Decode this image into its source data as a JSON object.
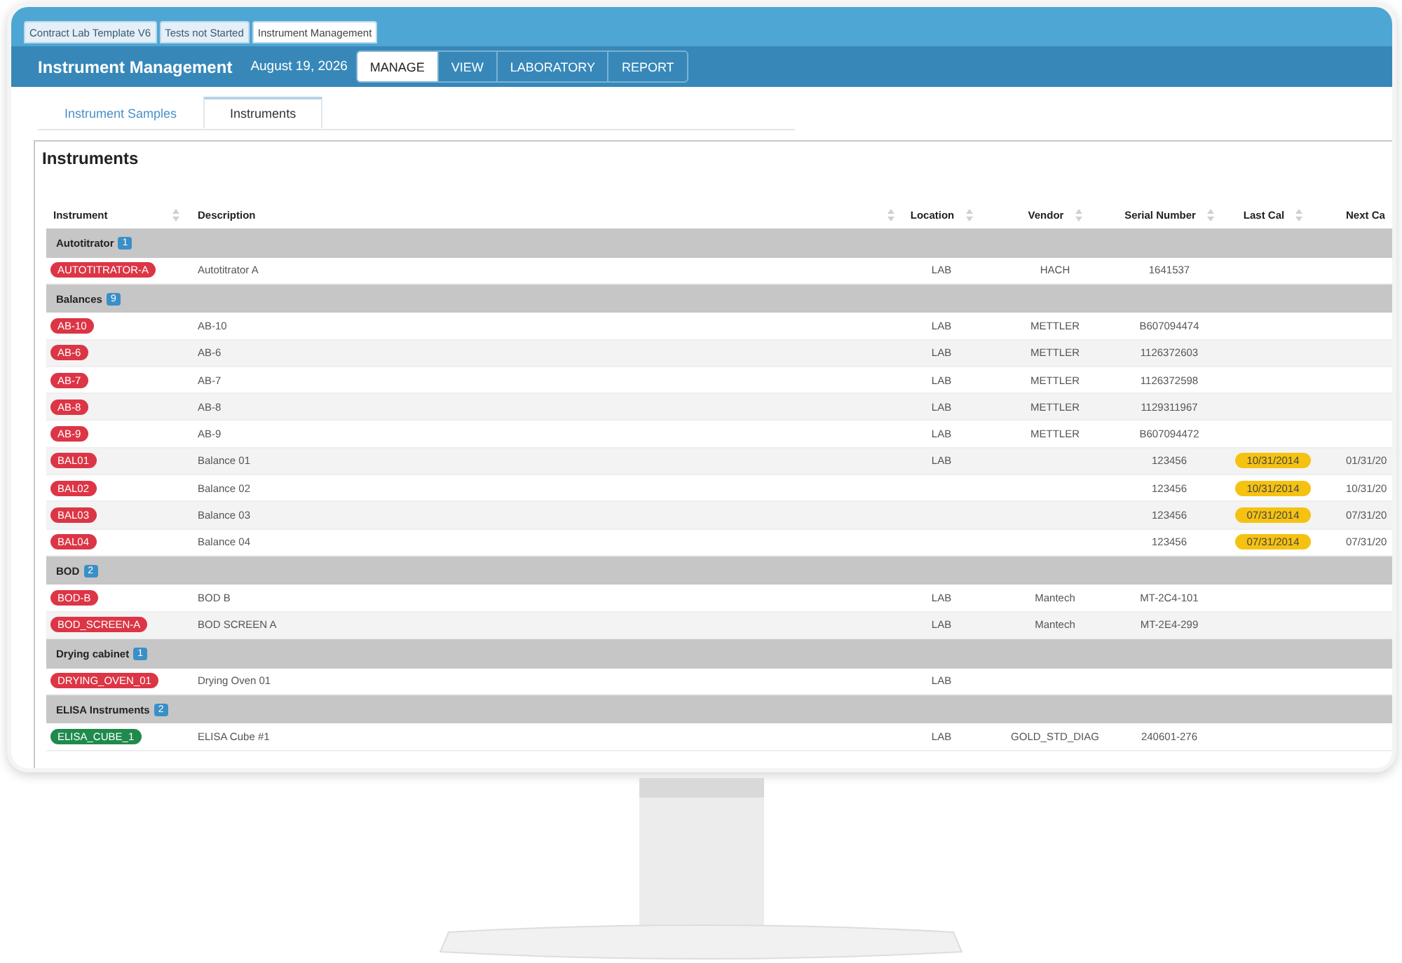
{
  "browser_tabs": [
    {
      "label": "Contract Lab Template V6",
      "selected": false
    },
    {
      "label": "Tests not Started",
      "selected": false
    },
    {
      "label": "Instrument Management",
      "selected": true
    }
  ],
  "header": {
    "title": "Instrument Management",
    "date": "August 19, 2026",
    "nav": [
      {
        "label": "MANAGE",
        "selected": true
      },
      {
        "label": "VIEW",
        "selected": false
      },
      {
        "label": "LABORATORY",
        "selected": false
      },
      {
        "label": "REPORT",
        "selected": false
      }
    ]
  },
  "subtabs": [
    {
      "label": "Instrument Samples",
      "selected": false
    },
    {
      "label": "Instruments",
      "selected": true
    }
  ],
  "panel": {
    "title": "Instruments",
    "columns": [
      {
        "label": "Instrument",
        "sortable": true
      },
      {
        "label": "Description",
        "sortable": true
      },
      {
        "label": "Location",
        "sortable": true
      },
      {
        "label": "Vendor",
        "sortable": true
      },
      {
        "label": "Serial Number",
        "sortable": true
      },
      {
        "label": "Last Cal",
        "sortable": true
      },
      {
        "label": "Next Ca",
        "sortable": false
      }
    ],
    "groups": [
      {
        "name": "Autotitrator",
        "count": "1",
        "rows": [
          {
            "instrument": "AUTOTITRATOR-A",
            "color": "#dc3545",
            "description": "Autotitrator A",
            "location": "LAB",
            "vendor": "HACH",
            "serial": "1641537"
          }
        ]
      },
      {
        "name": "Balances",
        "count": "9",
        "rows": [
          {
            "instrument": "AB-10",
            "color": "#dc3545",
            "description": "AB-10",
            "location": "LAB",
            "vendor": "METTLER",
            "serial": "B607094474"
          },
          {
            "instrument": "AB-6",
            "color": "#dc3545",
            "description": "AB-6",
            "location": "LAB",
            "vendor": "METTLER",
            "serial": "1126372603"
          },
          {
            "instrument": "AB-7",
            "color": "#dc3545",
            "description": "AB-7",
            "location": "LAB",
            "vendor": "METTLER",
            "serial": "1126372598"
          },
          {
            "instrument": "AB-8",
            "color": "#dc3545",
            "description": "AB-8",
            "location": "LAB",
            "vendor": "METTLER",
            "serial": "1129311967"
          },
          {
            "instrument": "AB-9",
            "color": "#dc3545",
            "description": "AB-9",
            "location": "LAB",
            "vendor": "METTLER",
            "serial": "B607094472"
          },
          {
            "instrument": "BAL01",
            "color": "#dc3545",
            "description": "Balance 01",
            "location": "LAB",
            "serial": "123456",
            "last_cal": "10/31/2014",
            "next_cal": "01/31/20"
          },
          {
            "instrument": "BAL02",
            "color": "#dc3545",
            "description": "Balance 02",
            "serial": "123456",
            "last_cal": "10/31/2014",
            "next_cal": "10/31/20"
          },
          {
            "instrument": "BAL03",
            "color": "#dc3545",
            "description": "Balance 03",
            "serial": "123456",
            "last_cal": "07/31/2014",
            "next_cal": "07/31/20"
          },
          {
            "instrument": "BAL04",
            "color": "#dc3545",
            "description": "Balance 04",
            "serial": "123456",
            "last_cal": "07/31/2014",
            "next_cal": "07/31/20"
          }
        ]
      },
      {
        "name": "BOD",
        "count": "2",
        "rows": [
          {
            "instrument": "BOD-B",
            "color": "#dc3545",
            "description": "BOD B",
            "location": "LAB",
            "vendor": "Mantech",
            "serial": "MT-2C4-101"
          },
          {
            "instrument": "BOD_SCREEN-A",
            "color": "#dc3545",
            "description": "BOD SCREEN A",
            "location": "LAB",
            "vendor": "Mantech",
            "serial": "MT-2E4-299"
          }
        ]
      },
      {
        "name": "Drying cabinet",
        "count": "1",
        "rows": [
          {
            "instrument": "DRYING_OVEN_01",
            "color": "#dc3545",
            "description": "Drying Oven 01",
            "location": "LAB"
          }
        ]
      },
      {
        "name": "ELISA Instruments",
        "count": "2",
        "rows": [
          {
            "instrument": "ELISA_CUBE_1",
            "color": "#1e8a4c",
            "description": "ELISA Cube #1",
            "location": "LAB",
            "vendor": "GOLD_STD_DIAG",
            "serial": "240601-276"
          }
        ]
      }
    ]
  }
}
